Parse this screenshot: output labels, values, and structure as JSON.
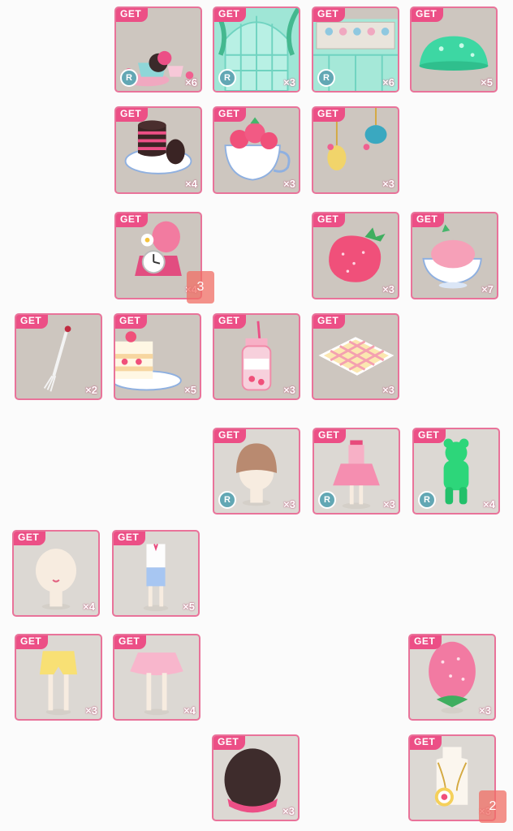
{
  "get_label": "GET",
  "rare_label": "R",
  "items": [
    {
      "icon": "tea-set-icon",
      "qty": "×6",
      "rare": true
    },
    {
      "icon": "greenhouse-window-icon",
      "qty": "×3",
      "rare": true
    },
    {
      "icon": "teacup-shelf-icon",
      "qty": "×6",
      "rare": true
    },
    {
      "icon": "green-jelly-icon",
      "qty": "×5",
      "rare": false
    },
    {
      "icon": "chocolate-cookies-icon",
      "qty": "×4",
      "rare": false
    },
    {
      "icon": "strawberry-teacup-icon",
      "qty": "×3",
      "rare": false
    },
    {
      "icon": "hanging-teapots-icon",
      "qty": "×3",
      "rare": false
    },
    {
      "icon": "strawberry-scale-icon",
      "qty": "×4",
      "rare": false
    },
    {
      "icon": "strawberry-icon",
      "qty": "×3",
      "rare": false
    },
    {
      "icon": "strawberry-ice-cream-cup-icon",
      "qty": "×7",
      "rare": false
    },
    {
      "icon": "fork-icon",
      "qty": "×2",
      "rare": false
    },
    {
      "icon": "strawberry-shortcake-icon",
      "qty": "×5",
      "rare": false
    },
    {
      "icon": "strawberry-milk-bottle-icon",
      "qty": "×3",
      "rare": false
    },
    {
      "icon": "picnic-cloth-icon",
      "qty": "×3",
      "rare": false
    },
    {
      "icon": "bowl-cut-hair-icon",
      "qty": "×3",
      "rare": true
    },
    {
      "icon": "pink-dress-icon",
      "qty": "×3",
      "rare": true
    },
    {
      "icon": "green-bear-suit-icon",
      "qty": "×4",
      "rare": true
    },
    {
      "icon": "bald-head-icon",
      "qty": "×4",
      "rare": false
    },
    {
      "icon": "suspender-outfit-icon",
      "qty": "×5",
      "rare": false
    },
    {
      "icon": "yellow-shorts-icon",
      "qty": "×3",
      "rare": false
    },
    {
      "icon": "pink-tutu-skirt-icon",
      "qty": "×4",
      "rare": false
    },
    {
      "icon": "strawberry-hat-icon",
      "qty": "×3",
      "rare": false
    },
    {
      "icon": "chocolate-macaron-hat-icon",
      "qty": "×3",
      "rare": false
    },
    {
      "icon": "strawberry-necklace-icon",
      "qty": "×3",
      "rare": false
    }
  ],
  "overlay_badges": [
    {
      "label": "3"
    },
    {
      "label": "2"
    }
  ]
}
